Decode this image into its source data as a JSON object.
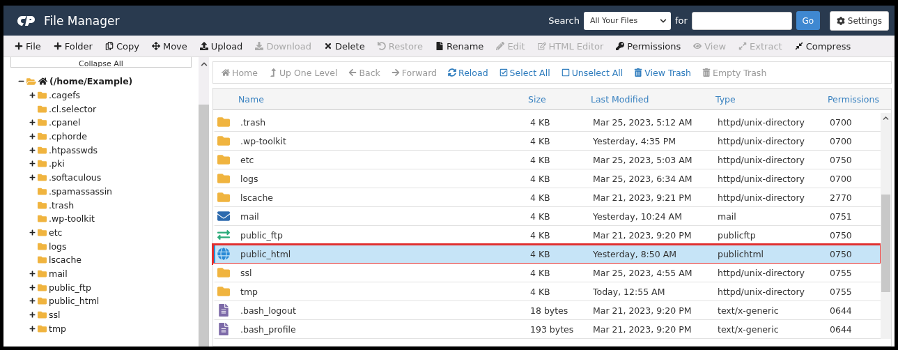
{
  "header": {
    "title": "File Manager",
    "search_label": "Search",
    "search_scope": "All Your Files",
    "for_label": "for",
    "go": "Go",
    "settings": "Settings"
  },
  "toolbar": [
    {
      "label": "File",
      "disabled": false
    },
    {
      "label": "Folder",
      "disabled": false
    },
    {
      "label": "Copy",
      "disabled": false
    },
    {
      "label": "Move",
      "disabled": false
    },
    {
      "label": "Upload",
      "disabled": false
    },
    {
      "label": "Download",
      "disabled": true
    },
    {
      "label": "Delete",
      "disabled": false
    },
    {
      "label": "Restore",
      "disabled": true
    },
    {
      "label": "Rename",
      "disabled": false
    },
    {
      "label": "Edit",
      "disabled": true
    },
    {
      "label": "HTML Editor",
      "disabled": true
    },
    {
      "label": "Permissions",
      "disabled": false
    },
    {
      "label": "View",
      "disabled": true
    },
    {
      "label": "Extract",
      "disabled": true
    },
    {
      "label": "Compress",
      "disabled": false
    }
  ],
  "sidebar": {
    "collapse": "Collapse All",
    "tree": {
      "label": "(/home/Example)",
      "expanded": true,
      "children": [
        {
          "label": ".cagefs",
          "expandable": true
        },
        {
          "label": ".cl.selector",
          "expandable": false
        },
        {
          "label": ".cpanel",
          "expandable": true
        },
        {
          "label": ".cphorde",
          "expandable": true
        },
        {
          "label": ".htpasswds",
          "expandable": true
        },
        {
          "label": ".pki",
          "expandable": true
        },
        {
          "label": ".softaculous",
          "expandable": true
        },
        {
          "label": ".spamassassin",
          "expandable": false
        },
        {
          "label": ".trash",
          "expandable": false
        },
        {
          "label": ".wp-toolkit",
          "expandable": false
        },
        {
          "label": "etc",
          "expandable": true
        },
        {
          "label": "logs",
          "expandable": false
        },
        {
          "label": "lscache",
          "expandable": false
        },
        {
          "label": "mail",
          "expandable": true
        },
        {
          "label": "public_ftp",
          "expandable": true
        },
        {
          "label": "public_html",
          "expandable": true
        },
        {
          "label": "ssl",
          "expandable": true
        },
        {
          "label": "tmp",
          "expandable": true
        }
      ]
    }
  },
  "nav": [
    {
      "label": "Home",
      "disabled": true
    },
    {
      "label": "Up One Level",
      "disabled": true
    },
    {
      "label": "Back",
      "disabled": true
    },
    {
      "label": "Forward",
      "disabled": true
    },
    {
      "label": "Reload",
      "disabled": false
    },
    {
      "label": "Select All",
      "disabled": false
    },
    {
      "label": "Unselect All",
      "disabled": false
    },
    {
      "label": "View Trash",
      "disabled": false
    },
    {
      "label": "Empty Trash",
      "disabled": true
    }
  ],
  "table": {
    "columns": [
      "Name",
      "Size",
      "Last Modified",
      "Type",
      "Permissions"
    ],
    "rows": [
      {
        "kind": "folder",
        "name": ".trash",
        "size": "4 KB",
        "modified": "Mar 25, 2023, 5:12 AM",
        "type": "httpd/unix-directory",
        "perms": "0700",
        "selected": false,
        "highlighted": false
      },
      {
        "kind": "folder",
        "name": ".wp-toolkit",
        "size": "4 KB",
        "modified": "Yesterday, 4:35 PM",
        "type": "httpd/unix-directory",
        "perms": "0700",
        "selected": false,
        "highlighted": false
      },
      {
        "kind": "folder",
        "name": "etc",
        "size": "4 KB",
        "modified": "Mar 25, 2023, 5:03 AM",
        "type": "httpd/unix-directory",
        "perms": "0750",
        "selected": false,
        "highlighted": false
      },
      {
        "kind": "folder",
        "name": "logs",
        "size": "4 KB",
        "modified": "Mar 25, 2023, 6:34 AM",
        "type": "httpd/unix-directory",
        "perms": "0700",
        "selected": false,
        "highlighted": false
      },
      {
        "kind": "folder",
        "name": "lscache",
        "size": "4 KB",
        "modified": "Mar 21, 2023, 9:21 PM",
        "type": "httpd/unix-directory",
        "perms": "2770",
        "selected": false,
        "highlighted": false
      },
      {
        "kind": "mail",
        "name": "mail",
        "size": "4 KB",
        "modified": "Yesterday, 10:24 AM",
        "type": "mail",
        "perms": "0751",
        "selected": false,
        "highlighted": false
      },
      {
        "kind": "ftp",
        "name": "public_ftp",
        "size": "4 KB",
        "modified": "Mar 21, 2023, 9:20 PM",
        "type": "publicftp",
        "perms": "0750",
        "selected": false,
        "highlighted": false
      },
      {
        "kind": "web",
        "name": "public_html",
        "size": "4 KB",
        "modified": "Yesterday, 8:50 AM",
        "type": "publichtml",
        "perms": "0750",
        "selected": true,
        "highlighted": true
      },
      {
        "kind": "folder",
        "name": "ssl",
        "size": "4 KB",
        "modified": "Mar 25, 2023, 4:55 AM",
        "type": "httpd/unix-directory",
        "perms": "0755",
        "selected": false,
        "highlighted": false
      },
      {
        "kind": "folder",
        "name": "tmp",
        "size": "4 KB",
        "modified": "Today, 12:55 AM",
        "type": "httpd/unix-directory",
        "perms": "0755",
        "selected": false,
        "highlighted": false
      },
      {
        "kind": "file",
        "name": ".bash_logout",
        "size": "18 bytes",
        "modified": "Mar 21, 2023, 9:20 PM",
        "type": "text/x-generic",
        "perms": "0644",
        "selected": false,
        "highlighted": false
      },
      {
        "kind": "file",
        "name": ".bash_profile",
        "size": "193 bytes",
        "modified": "Mar 21, 2023, 9:20 PM",
        "type": "text/x-generic",
        "perms": "0644",
        "selected": false,
        "highlighted": false
      }
    ]
  }
}
